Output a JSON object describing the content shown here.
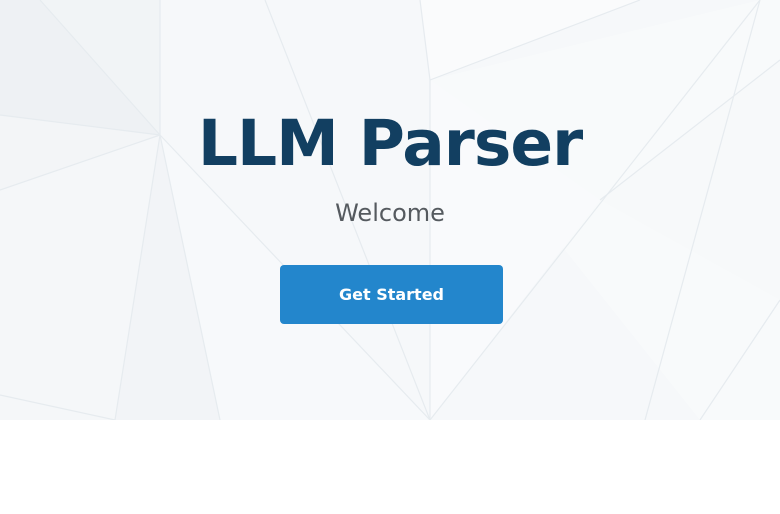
{
  "hero": {
    "title": "LLM Parser",
    "subtitle": "Welcome",
    "cta_label": "Get Started",
    "background_pattern": "low-poly-geometric-lines"
  },
  "colors": {
    "title": "#123f61",
    "subtitle": "#555a5f",
    "cta_background": "#2386cc",
    "cta_text": "#ffffff",
    "hero_background": "#f6f8fa",
    "page_background": "#ffffff"
  }
}
